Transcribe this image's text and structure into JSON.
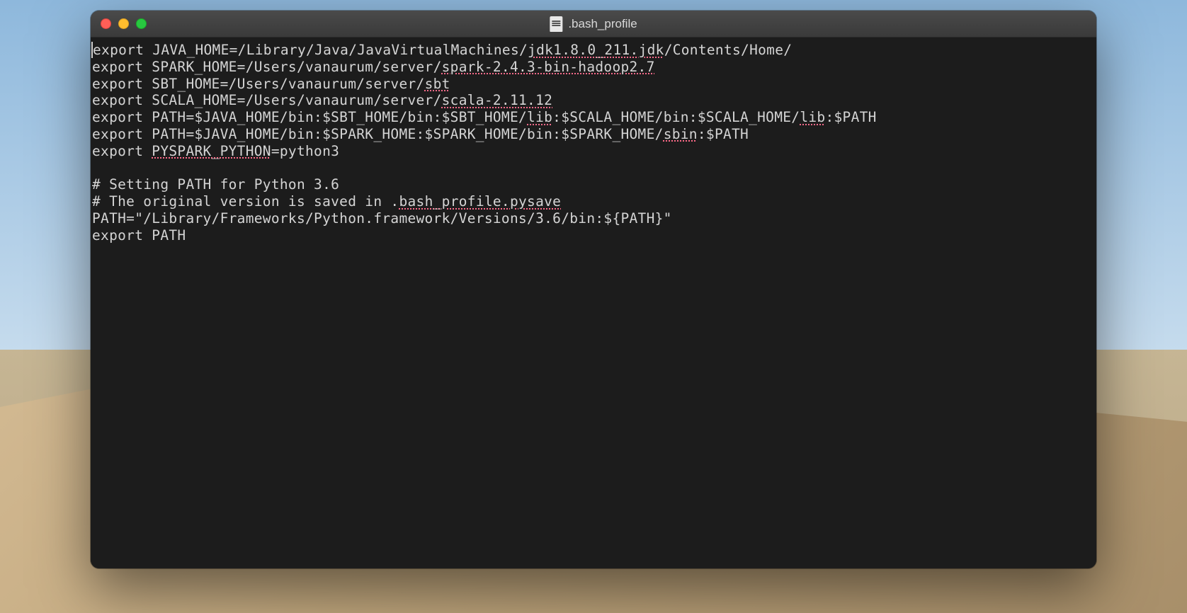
{
  "window": {
    "title": ".bash_profile"
  },
  "editor": {
    "lines": [
      [
        {
          "t": "export JAVA_HOME=/Library/Java/JavaVirtualMachines/",
          "s": false
        },
        {
          "t": "jdk1.8.0_211.jdk",
          "s": true
        },
        {
          "t": "/Contents/Home/",
          "s": false
        }
      ],
      [
        {
          "t": "export SPARK_HOME=/Users/vanaurum/server/",
          "s": false
        },
        {
          "t": "spark-2.4.3-bin-hadoop2.7",
          "s": true
        }
      ],
      [
        {
          "t": "export SBT_HOME=/Users/vanaurum/server/",
          "s": false
        },
        {
          "t": "sbt",
          "s": true
        }
      ],
      [
        {
          "t": "export SCALA_HOME=/Users/vanaurum/server/",
          "s": false
        },
        {
          "t": "scala-2.11.12",
          "s": true
        }
      ],
      [
        {
          "t": "export PATH=$JAVA_HOME/bin:$SBT_HOME/bin:$SBT_HOME/",
          "s": false
        },
        {
          "t": "lib",
          "s": true
        },
        {
          "t": ":$SCALA_HOME/bin:$SCALA_HOME/",
          "s": false
        },
        {
          "t": "lib",
          "s": true
        },
        {
          "t": ":$PATH",
          "s": false
        }
      ],
      [
        {
          "t": "export PATH=$JAVA_HOME/bin:$SPARK_HOME:$SPARK_HOME/bin:$SPARK_HOME/",
          "s": false
        },
        {
          "t": "sbin",
          "s": true
        },
        {
          "t": ":$PATH",
          "s": false
        }
      ],
      [
        {
          "t": "export ",
          "s": false
        },
        {
          "t": "PYSPARK_PYTHON",
          "s": true
        },
        {
          "t": "=python3",
          "s": false
        }
      ],
      [
        {
          "t": "",
          "s": false
        }
      ],
      [
        {
          "t": "# Setting PATH for Python 3.6",
          "s": false
        }
      ],
      [
        {
          "t": "# The original version is saved in .",
          "s": false
        },
        {
          "t": "bash_profile.pysave",
          "s": true
        }
      ],
      [
        {
          "t": "PATH=\"/Library/Frameworks/Python.framework/Versions/3.6/bin:${PATH}\"",
          "s": false
        }
      ],
      [
        {
          "t": "export PATH",
          "s": false
        }
      ]
    ]
  }
}
